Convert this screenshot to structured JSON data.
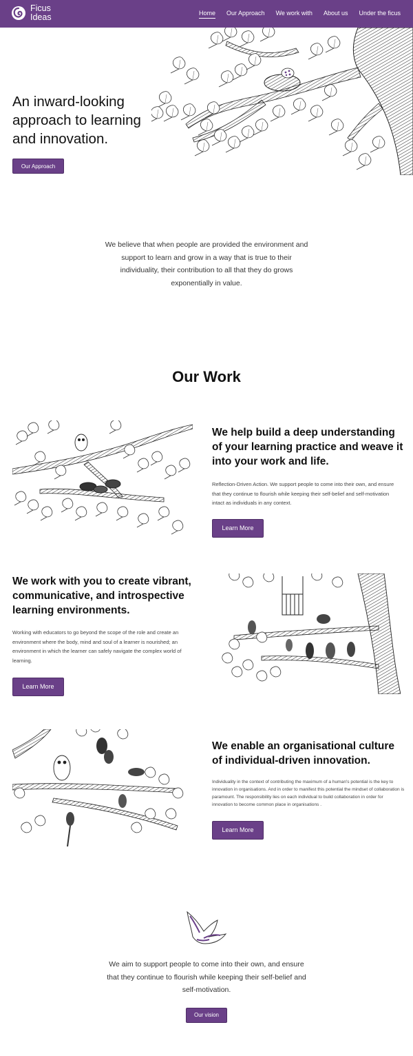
{
  "brand": {
    "line1": "Ficus",
    "line2": "Ideas",
    "accent": "#6a4088"
  },
  "nav": {
    "items": [
      {
        "label": "Home"
      },
      {
        "label": "Our Approach"
      },
      {
        "label": "We work with"
      },
      {
        "label": "About us"
      },
      {
        "label": "Under the ficus"
      }
    ]
  },
  "hero": {
    "title": "An inward-looking approach to learning and innovation.",
    "button": "Our Approach",
    "image": "tree-branch-bird-nest-illustration"
  },
  "belief": {
    "text": "We believe that when people are provided the environment and support to learn and grow in a way that is true to their individuality, their contribution to all that they do grows exponentially in value."
  },
  "work": {
    "title": "Our Work",
    "items": [
      {
        "heading": "We help build a deep understanding of your learning practice and weave it into your work and life.",
        "body": "Reflection-Driven Action. We support people to come into their own, and ensure that they continue to flourish while keeping their self-belief and self-motivation intact as individuals in any context.",
        "button": "Learn More",
        "image": "branch-with-owl-and-birds-illustration"
      },
      {
        "heading_before": "We work with you to create vibrant, communicative, and introspective learning ",
        "heading_bold": "environments",
        "heading_after": ".",
        "body": "Working with educators to go beyond the scope of the role and create an environment where the body, mind and soul of a learner is nourished; an environment in which the learner can safely navigate the complex world of learning.",
        "button": "Learn More",
        "image": "tree-with-birds-and-cage-illustration"
      },
      {
        "heading_before": "We enable an ",
        "heading_bold": "organisational",
        "heading_after": " culture of individual-driven innovation.",
        "body": "Individuality in the context of contributing the maximum of a human's potential is the key to innovation in organisations. And in order to manifest this potential the mindset of collaboration is paramount. The responsibility lies on each individual to build collaboration in order for innovation to become common place in organisations .",
        "button": "Learn More",
        "image": "branch-with-owl-bats-birds-illustration"
      }
    ]
  },
  "aim": {
    "text": "We aim to support people to come into their own, and ensure that they continue to flourish while keeping their self-belief and self-motivation.",
    "button": "Our vision",
    "image": "flying-bird-icon"
  }
}
